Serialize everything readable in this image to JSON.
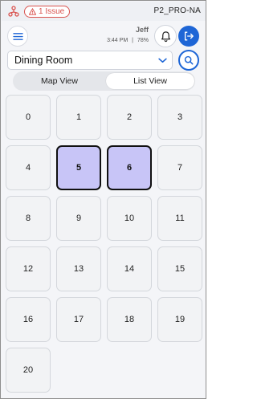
{
  "status": {
    "issue_label": "1 Issue",
    "device_id": "P2_PRO-NA"
  },
  "header": {
    "user_name": "Jeff",
    "time": "3:44 PM",
    "separator": "|",
    "battery": "78%"
  },
  "room": {
    "selected": "Dining Room"
  },
  "view_toggle": {
    "map_label": "Map View",
    "list_label": "List View",
    "active": "List View"
  },
  "tables": [
    {
      "label": "0",
      "selected": false
    },
    {
      "label": "1",
      "selected": false
    },
    {
      "label": "2",
      "selected": false
    },
    {
      "label": "3",
      "selected": false
    },
    {
      "label": "4",
      "selected": false
    },
    {
      "label": "5",
      "selected": true
    },
    {
      "label": "6",
      "selected": true
    },
    {
      "label": "7",
      "selected": false
    },
    {
      "label": "8",
      "selected": false
    },
    {
      "label": "9",
      "selected": false
    },
    {
      "label": "10",
      "selected": false
    },
    {
      "label": "11",
      "selected": false
    },
    {
      "label": "12",
      "selected": false
    },
    {
      "label": "13",
      "selected": false
    },
    {
      "label": "14",
      "selected": false
    },
    {
      "label": "15",
      "selected": false
    },
    {
      "label": "16",
      "selected": false
    },
    {
      "label": "17",
      "selected": false
    },
    {
      "label": "18",
      "selected": false
    },
    {
      "label": "19",
      "selected": false
    },
    {
      "label": "20",
      "selected": false
    }
  ],
  "colors": {
    "accent": "#1e66d6",
    "issue": "#d9534f",
    "selected_tile": "#c8c5f7"
  }
}
